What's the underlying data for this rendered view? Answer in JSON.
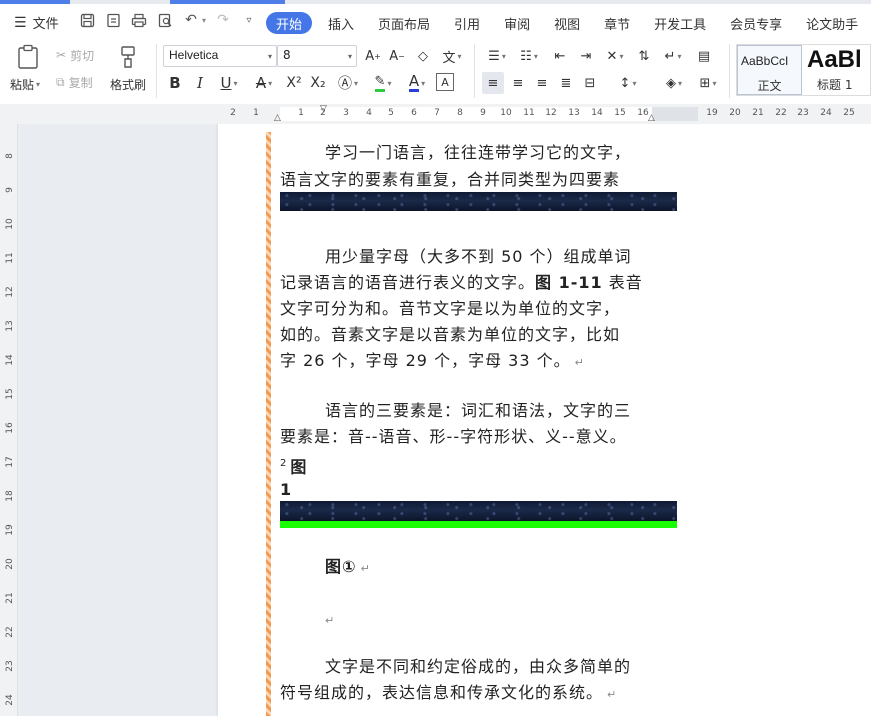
{
  "menubar": {
    "file_label": "文件",
    "tabs": [
      "开始",
      "插入",
      "页面布局",
      "引用",
      "审阅",
      "视图",
      "章节",
      "开发工具",
      "会员专享",
      "论文助手"
    ],
    "active_tab": "开始"
  },
  "toolbar": {
    "paste_label": "粘贴",
    "cut_label": "剪切",
    "copy_label": "复制",
    "format_painter_label": "格式刷",
    "font_name": "Helvetica",
    "font_size": "8",
    "bold": "B",
    "italic": "I",
    "underline": "U",
    "strikethrough": "A",
    "superscript": "X²",
    "subscript": "X₂",
    "font_color": "A",
    "style_normal_preview": "AaBbCcI",
    "style_normal_label": "正文",
    "style_h1_preview": "AaBl",
    "style_h1_label": "标题 1"
  },
  "ruler": {
    "h_numbers": [
      "2",
      "1",
      "1",
      "2",
      "3",
      "4",
      "5",
      "6",
      "7",
      "8",
      "9",
      "10",
      "11",
      "12",
      "13",
      "14",
      "15",
      "16",
      "19",
      "20",
      "21",
      "22",
      "23",
      "24",
      "25"
    ],
    "v_numbers": [
      "8",
      "9",
      "10",
      "11",
      "12",
      "13",
      "14",
      "15",
      "16",
      "17",
      "18",
      "19",
      "20",
      "21",
      "22",
      "23",
      "24"
    ]
  },
  "document": {
    "p1_l1": "学习一门语言，往往连带学习它的文字，",
    "p1_l2": "语言文字的要素有重复，合并同类型为四要素",
    "p2_l1": "用少量字母（大多不到 50 个）组成单词",
    "p2_l2a": "记录语言的语音进行表义的文字。",
    "p2_l2b": "图 1-11",
    "p2_l2c": " 表音",
    "p2_l3": "文字可分为和。音节文字是以为单位的文字，",
    "p2_l4": "如的。音素文字是以音素为单位的文字，比如",
    "p2_l5": "字 26 个，字母 29 个，字母 33 个。",
    "p3_l1": "语言的三要素是：词汇和语法，文字的三",
    "p3_l2": "要素是：音--语音、形--字符形状、义--意义。",
    "fig_sup": "2",
    "fig_label": "图",
    "fig_num": "1",
    "caption": "图①",
    "p4_l1": "文字是不同和约定俗成的，由众多简单的",
    "p4_l2": "符号组成的，表达信息和传承文化的系统。",
    "para_mark": "↵"
  }
}
